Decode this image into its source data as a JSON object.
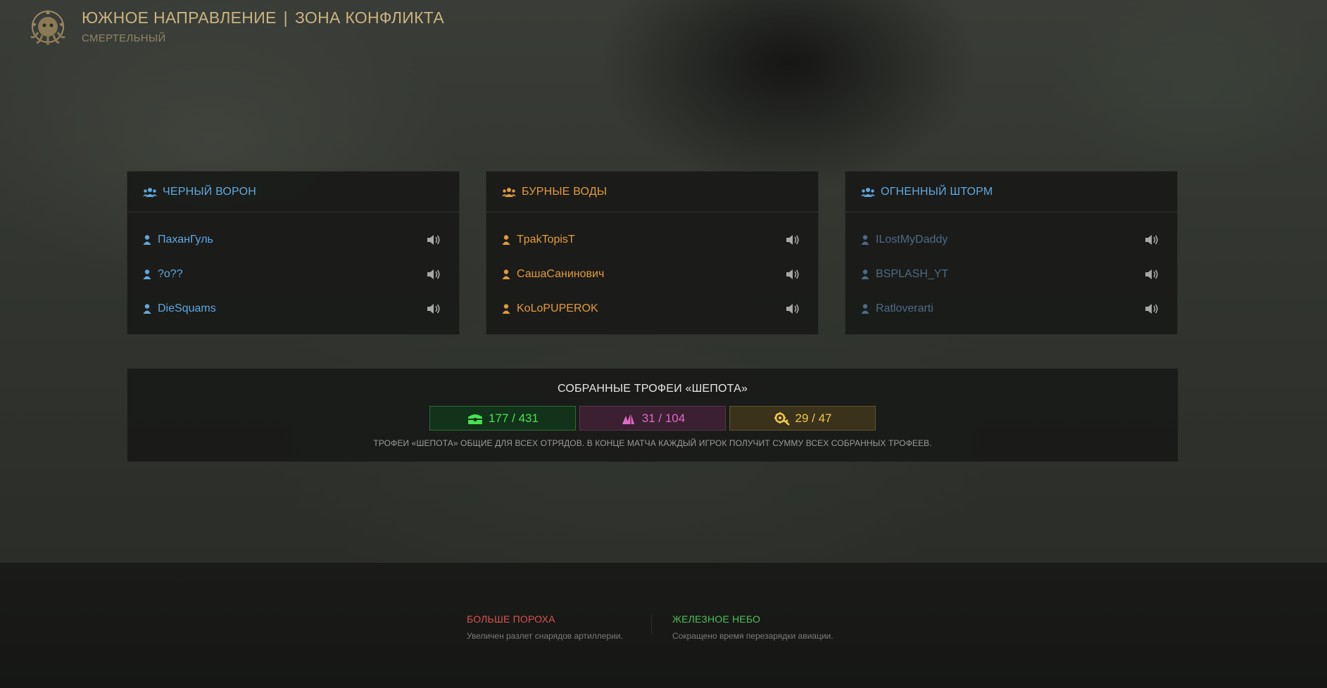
{
  "header": {
    "title_part1": "ЮЖНОЕ НАПРАВЛЕНИЕ",
    "separator": "|",
    "title_part2": "ЗОНА КОНФЛИКТА",
    "difficulty": "СМЕРТЕЛЬНЫЙ",
    "logo_icon": "kraken-emblem-icon"
  },
  "squads": [
    {
      "name": "ЧЕРНЫЙ ВОРОН",
      "color": "#5fa8e0",
      "players": [
        {
          "name": "ПаханГуль"
        },
        {
          "name": "?o??"
        },
        {
          "name": "DieSquams"
        }
      ]
    },
    {
      "name": "БУРНЫЕ ВОДЫ",
      "color": "#e39a3d",
      "players": [
        {
          "name": "TpakTopisT"
        },
        {
          "name": "СашаСанинович"
        },
        {
          "name": "KoLoPUPEROK"
        }
      ]
    },
    {
      "name": "ОГНЕННЫЙ ШТОРМ",
      "color": "#5fa8e0",
      "player_color": "#4d6a86",
      "players": [
        {
          "name": "ILostMyDaddy"
        },
        {
          "name": "BSPLASH_YT"
        },
        {
          "name": "Ratloverarti"
        }
      ]
    }
  ],
  "trophies": {
    "title": "СОБРАННЫЕ ТРОФЕИ «ШЕПОТА»",
    "counters": [
      {
        "icon": "chest-icon",
        "value": "177 / 431",
        "color": "#47e24f"
      },
      {
        "icon": "crystals-icon",
        "value": "31 / 104",
        "color": "#e06ac7"
      },
      {
        "icon": "gear-part-icon",
        "value": "29 / 47",
        "color": "#f0c84a"
      }
    ],
    "note": "ТРОФЕИ «ШЕПОТА» ОБЩИЕ ДЛЯ ВСЕХ ОТРЯДОВ. В КОНЦЕ МАТЧА КАЖДЫЙ ИГРОК ПОЛУЧИТ СУММУ ВСЕХ СОБРАННЫХ ТРОФЕЕВ."
  },
  "modifiers": [
    {
      "title": "БОЛЬШЕ ПОРОХА",
      "description": "Увеличен разлет снарядов артиллерии.",
      "color": "#d9534f"
    },
    {
      "title": "ЖЕЛЕЗНОЕ НЕБО",
      "description": "Сокращено время перезарядки авиации.",
      "color": "#4cbf5a"
    }
  ]
}
